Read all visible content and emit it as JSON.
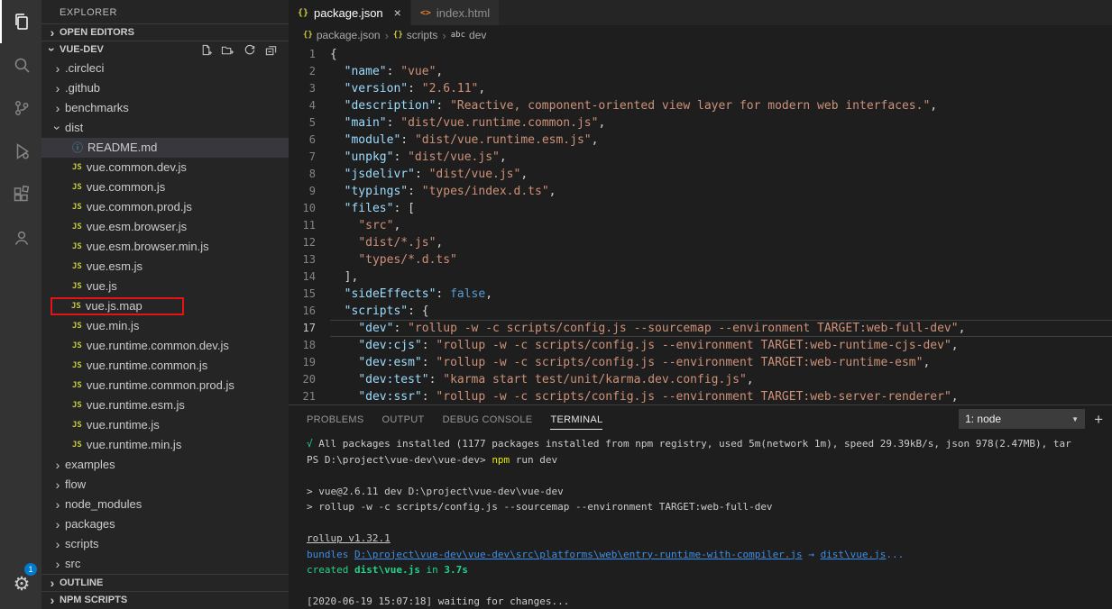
{
  "activity_bar": {
    "badge": "1",
    "icons": [
      "explorer",
      "search",
      "source-control",
      "run-and-debug",
      "extensions",
      "accounts",
      "settings-gear"
    ]
  },
  "sidebar": {
    "title": "EXPLORER",
    "open_editors_label": "OPEN EDITORS",
    "workspace_label": "VUE-DEV",
    "outline_label": "OUTLINE",
    "npm_scripts_label": "NPM SCRIPTS",
    "tree": [
      {
        "label": ".circleci",
        "kind": "folder",
        "expanded": false,
        "indent": 0
      },
      {
        "label": ".github",
        "kind": "folder",
        "expanded": false,
        "indent": 0
      },
      {
        "label": "benchmarks",
        "kind": "folder",
        "expanded": false,
        "indent": 0
      },
      {
        "label": "dist",
        "kind": "folder",
        "expanded": true,
        "indent": 0
      },
      {
        "label": "README.md",
        "kind": "file",
        "icon": "info",
        "indent": 1,
        "selected": true
      },
      {
        "label": "vue.common.dev.js",
        "kind": "file",
        "icon": "js",
        "indent": 1
      },
      {
        "label": "vue.common.js",
        "kind": "file",
        "icon": "js",
        "indent": 1
      },
      {
        "label": "vue.common.prod.js",
        "kind": "file",
        "icon": "js",
        "indent": 1
      },
      {
        "label": "vue.esm.browser.js",
        "kind": "file",
        "icon": "js",
        "indent": 1
      },
      {
        "label": "vue.esm.browser.min.js",
        "kind": "file",
        "icon": "js",
        "indent": 1
      },
      {
        "label": "vue.esm.js",
        "kind": "file",
        "icon": "js",
        "indent": 1
      },
      {
        "label": "vue.js",
        "kind": "file",
        "icon": "js",
        "indent": 1
      },
      {
        "label": "vue.js.map",
        "kind": "file",
        "icon": "js",
        "indent": 1,
        "boxed": true
      },
      {
        "label": "vue.min.js",
        "kind": "file",
        "icon": "js",
        "indent": 1
      },
      {
        "label": "vue.runtime.common.dev.js",
        "kind": "file",
        "icon": "js",
        "indent": 1
      },
      {
        "label": "vue.runtime.common.js",
        "kind": "file",
        "icon": "js",
        "indent": 1
      },
      {
        "label": "vue.runtime.common.prod.js",
        "kind": "file",
        "icon": "js",
        "indent": 1
      },
      {
        "label": "vue.runtime.esm.js",
        "kind": "file",
        "icon": "js",
        "indent": 1
      },
      {
        "label": "vue.runtime.js",
        "kind": "file",
        "icon": "js",
        "indent": 1
      },
      {
        "label": "vue.runtime.min.js",
        "kind": "file",
        "icon": "js",
        "indent": 1
      },
      {
        "label": "examples",
        "kind": "folder",
        "expanded": false,
        "indent": 0
      },
      {
        "label": "flow",
        "kind": "folder",
        "expanded": false,
        "indent": 0
      },
      {
        "label": "node_modules",
        "kind": "folder",
        "expanded": false,
        "indent": 0
      },
      {
        "label": "packages",
        "kind": "folder",
        "expanded": false,
        "indent": 0
      },
      {
        "label": "scripts",
        "kind": "folder",
        "expanded": false,
        "indent": 0
      },
      {
        "label": "src",
        "kind": "folder",
        "expanded": false,
        "indent": 0
      }
    ]
  },
  "editor": {
    "tabs": [
      {
        "label": "package.json",
        "icon": "{}",
        "close": "×",
        "active": true
      },
      {
        "label": "index.html",
        "icon": "<>",
        "active": false
      }
    ],
    "breadcrumb": [
      {
        "icon": "{}",
        "label": "package.json"
      },
      {
        "icon": "{}",
        "label": "scripts"
      },
      {
        "icon": "abc",
        "label": "dev"
      }
    ],
    "current_line": 17,
    "lines": [
      {
        "n": 1,
        "s": [
          [
            "p",
            "{"
          ]
        ]
      },
      {
        "n": 2,
        "s": [
          [
            "p",
            "  "
          ],
          [
            "k",
            "\"name\""
          ],
          [
            "p",
            ": "
          ],
          [
            "s",
            "\"vue\""
          ],
          [
            "p",
            ","
          ]
        ]
      },
      {
        "n": 3,
        "s": [
          [
            "p",
            "  "
          ],
          [
            "k",
            "\"version\""
          ],
          [
            "p",
            ": "
          ],
          [
            "s",
            "\"2.6.11\""
          ],
          [
            "p",
            ","
          ]
        ]
      },
      {
        "n": 4,
        "s": [
          [
            "p",
            "  "
          ],
          [
            "k",
            "\"description\""
          ],
          [
            "p",
            ": "
          ],
          [
            "s",
            "\"Reactive, component-oriented view layer for modern web interfaces.\""
          ],
          [
            "p",
            ","
          ]
        ]
      },
      {
        "n": 5,
        "s": [
          [
            "p",
            "  "
          ],
          [
            "k",
            "\"main\""
          ],
          [
            "p",
            ": "
          ],
          [
            "s",
            "\"dist/vue.runtime.common.js\""
          ],
          [
            "p",
            ","
          ]
        ]
      },
      {
        "n": 6,
        "s": [
          [
            "p",
            "  "
          ],
          [
            "k",
            "\"module\""
          ],
          [
            "p",
            ": "
          ],
          [
            "s",
            "\"dist/vue.runtime.esm.js\""
          ],
          [
            "p",
            ","
          ]
        ]
      },
      {
        "n": 7,
        "s": [
          [
            "p",
            "  "
          ],
          [
            "k",
            "\"unpkg\""
          ],
          [
            "p",
            ": "
          ],
          [
            "s",
            "\"dist/vue.js\""
          ],
          [
            "p",
            ","
          ]
        ]
      },
      {
        "n": 8,
        "s": [
          [
            "p",
            "  "
          ],
          [
            "k",
            "\"jsdelivr\""
          ],
          [
            "p",
            ": "
          ],
          [
            "s",
            "\"dist/vue.js\""
          ],
          [
            "p",
            ","
          ]
        ]
      },
      {
        "n": 9,
        "s": [
          [
            "p",
            "  "
          ],
          [
            "k",
            "\"typings\""
          ],
          [
            "p",
            ": "
          ],
          [
            "s",
            "\"types/index.d.ts\""
          ],
          [
            "p",
            ","
          ]
        ]
      },
      {
        "n": 10,
        "s": [
          [
            "p",
            "  "
          ],
          [
            "k",
            "\"files\""
          ],
          [
            "p",
            ": ["
          ]
        ]
      },
      {
        "n": 11,
        "s": [
          [
            "p",
            "    "
          ],
          [
            "s",
            "\"src\""
          ],
          [
            "p",
            ","
          ]
        ]
      },
      {
        "n": 12,
        "s": [
          [
            "p",
            "    "
          ],
          [
            "s",
            "\"dist/*.js\""
          ],
          [
            "p",
            ","
          ]
        ]
      },
      {
        "n": 13,
        "s": [
          [
            "p",
            "    "
          ],
          [
            "s",
            "\"types/*.d.ts\""
          ]
        ]
      },
      {
        "n": 14,
        "s": [
          [
            "p",
            "  ],"
          ]
        ]
      },
      {
        "n": 15,
        "s": [
          [
            "p",
            "  "
          ],
          [
            "k",
            "\"sideEffects\""
          ],
          [
            "p",
            ": "
          ],
          [
            "b",
            "false"
          ],
          [
            "p",
            ","
          ]
        ]
      },
      {
        "n": 16,
        "s": [
          [
            "p",
            "  "
          ],
          [
            "k",
            "\"scripts\""
          ],
          [
            "p",
            ": {"
          ]
        ]
      },
      {
        "n": 17,
        "s": [
          [
            "p",
            "    "
          ],
          [
            "k",
            "\"dev\""
          ],
          [
            "p",
            ": "
          ],
          [
            "s",
            "\"rollup -w -c scripts/config.js --sourcemap --environment TARGET:web-full-dev\""
          ],
          [
            "p",
            ","
          ]
        ]
      },
      {
        "n": 18,
        "s": [
          [
            "p",
            "    "
          ],
          [
            "k",
            "\"dev:cjs\""
          ],
          [
            "p",
            ": "
          ],
          [
            "s",
            "\"rollup -w -c scripts/config.js --environment TARGET:web-runtime-cjs-dev\""
          ],
          [
            "p",
            ","
          ]
        ]
      },
      {
        "n": 19,
        "s": [
          [
            "p",
            "    "
          ],
          [
            "k",
            "\"dev:esm\""
          ],
          [
            "p",
            ": "
          ],
          [
            "s",
            "\"rollup -w -c scripts/config.js --environment TARGET:web-runtime-esm\""
          ],
          [
            "p",
            ","
          ]
        ]
      },
      {
        "n": 20,
        "s": [
          [
            "p",
            "    "
          ],
          [
            "k",
            "\"dev:test\""
          ],
          [
            "p",
            ": "
          ],
          [
            "s",
            "\"karma start test/unit/karma.dev.config.js\""
          ],
          [
            "p",
            ","
          ]
        ]
      },
      {
        "n": 21,
        "s": [
          [
            "p",
            "    "
          ],
          [
            "k",
            "\"dev:ssr\""
          ],
          [
            "p",
            ": "
          ],
          [
            "s",
            "\"rollup -w -c scripts/config.js --environment TARGET:web-server-renderer\""
          ],
          [
            "p",
            ","
          ]
        ]
      }
    ]
  },
  "panel": {
    "tabs": [
      "PROBLEMS",
      "OUTPUT",
      "DEBUG CONSOLE",
      "TERMINAL"
    ],
    "active_tab": "TERMINAL",
    "shell_selector": "1: node",
    "terminal_lines": [
      [
        [
          "g",
          "√"
        ],
        [
          "w",
          " All packages installed (1177 packages installed from npm registry, used 5m(network 1m), speed 29.39kB/s, json 978(2.47MB), tar"
        ]
      ],
      [
        [
          "w",
          "PS D:\\project\\vue-dev\\vue-dev> "
        ],
        [
          "y",
          "npm"
        ],
        [
          "w",
          " run dev"
        ]
      ],
      [],
      [
        [
          "w",
          "> vue@2.6.11 dev D:\\project\\vue-dev\\vue-dev"
        ]
      ],
      [
        [
          "w",
          "> rollup -w -c scripts/config.js --sourcemap --environment TARGET:web-full-dev"
        ]
      ],
      [],
      [
        [
          "wu",
          "rollup v1.32.1"
        ]
      ],
      [
        [
          "c",
          "bundles "
        ],
        [
          "cu",
          "D:\\project\\vue-dev\\vue-dev\\src\\platforms\\web\\entry-runtime-with-compiler.js"
        ],
        [
          "c",
          " → "
        ],
        [
          "cu",
          "dist\\vue.js"
        ],
        [
          "c",
          "..."
        ]
      ],
      [
        [
          "g",
          "created "
        ],
        [
          "gb",
          "dist\\vue.js"
        ],
        [
          "g",
          " in "
        ],
        [
          "gb",
          "3.7s"
        ]
      ],
      [],
      [
        [
          "w",
          "[2020-06-19 15:07:18] waiting for changes..."
        ]
      ]
    ]
  }
}
